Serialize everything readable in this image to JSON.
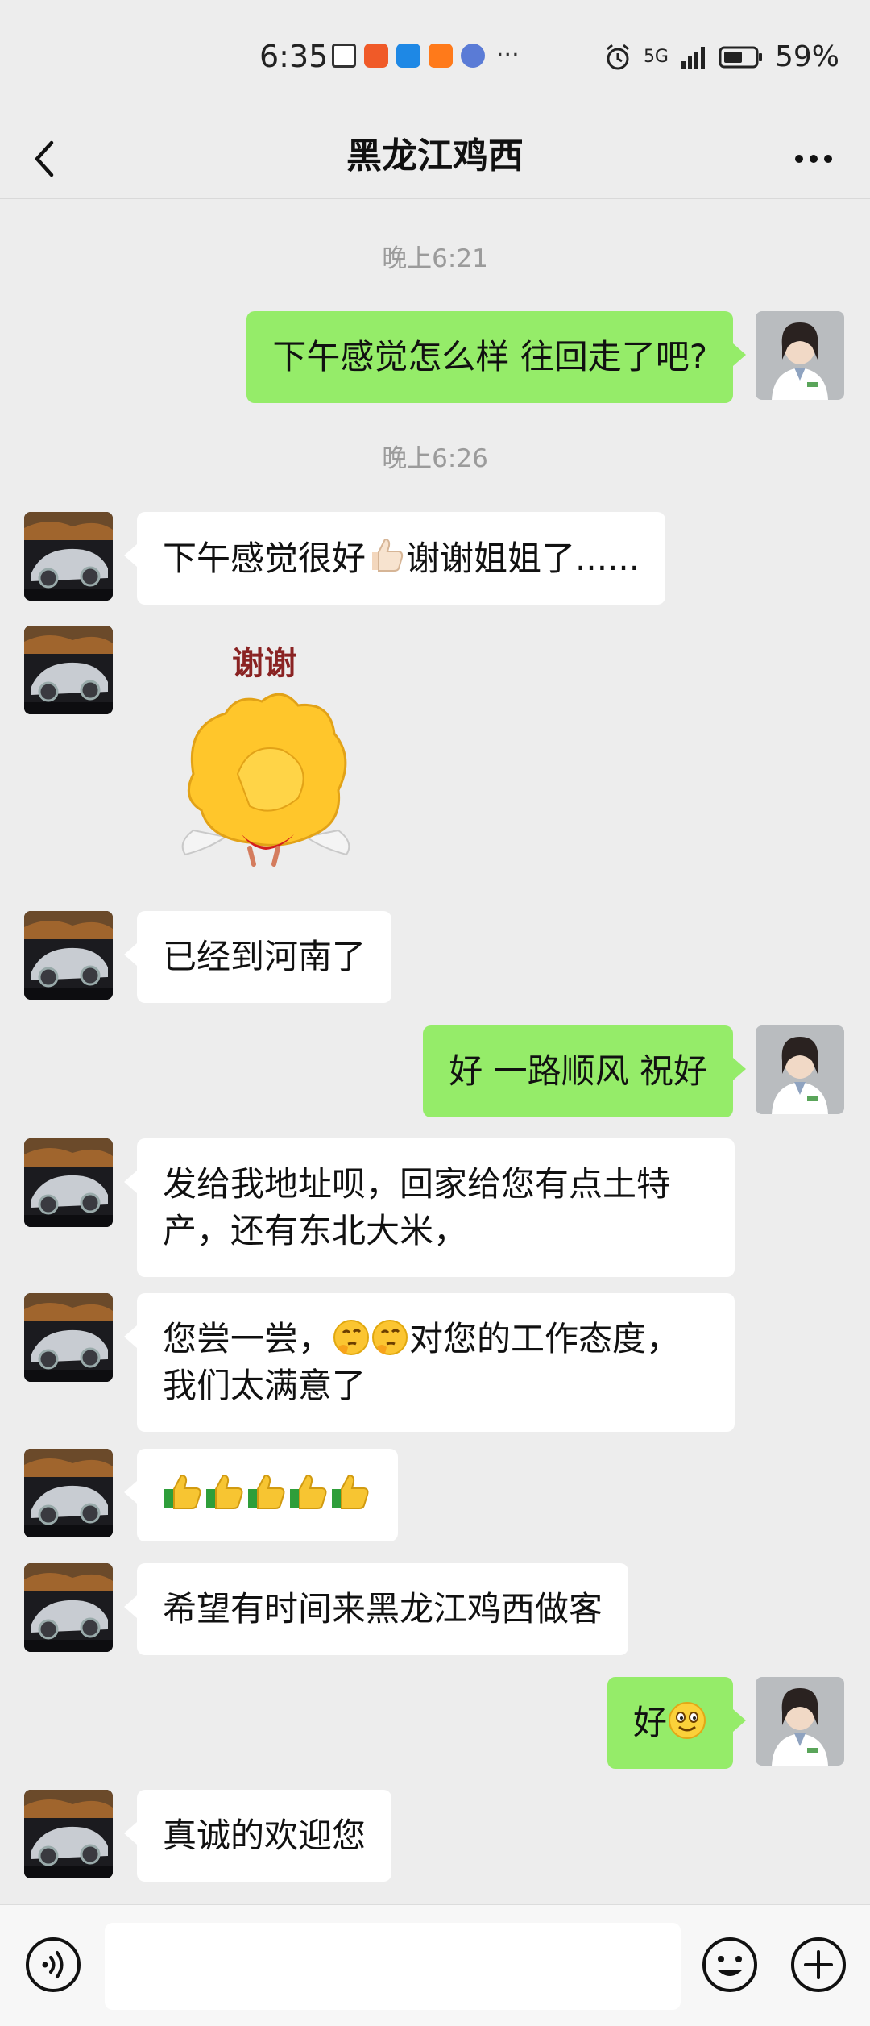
{
  "status_bar": {
    "time": "6:35",
    "battery_percent": "59%",
    "network": "5G"
  },
  "header": {
    "title": "黑龙江鸡西"
  },
  "timestamps": [
    "晚上6:21",
    "晚上6:26"
  ],
  "messages": [
    {
      "side": "right",
      "text": "下午感觉怎么样 往回走了吧?"
    },
    {
      "side": "left",
      "text_before": "下午感觉很好",
      "emoji": "thumbs-up",
      "text_after": "谢谢姐姐了......"
    },
    {
      "side": "left",
      "sticker": "thanks-chick-sticker",
      "sticker_text": "谢谢"
    },
    {
      "side": "left",
      "text": "已经到河南了"
    },
    {
      "side": "right",
      "text": "好 一路顺风 祝好"
    },
    {
      "side": "left",
      "text": "发给我地址呗，回家给您有点土特产，还有东北大米，"
    },
    {
      "side": "left",
      "text_before": "您尝一尝，",
      "emoji": "thinking-face",
      "text_after": "对您的工作态度，我们太满意了"
    },
    {
      "side": "left",
      "emoji_row": "thumbs-up x5"
    },
    {
      "side": "left",
      "text": "希望有时间来黑龙江鸡西做客"
    },
    {
      "side": "right",
      "text": "好",
      "emoji": "smile"
    },
    {
      "side": "left",
      "text": "真诚的欢迎您"
    }
  ],
  "input_bar": {
    "placeholder": ""
  },
  "colors": {
    "self_bubble": "#95ec69",
    "other_bubble": "#ffffff",
    "background": "#ededed"
  }
}
